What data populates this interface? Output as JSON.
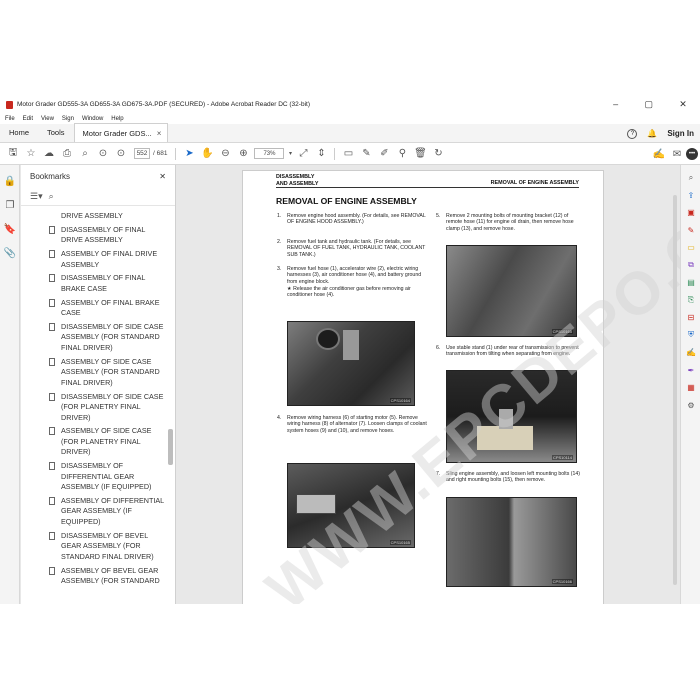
{
  "window": {
    "title": "Motor Grader GD555-3A GD655-3A GD675-3A.PDF (SECURED) - Adobe Acrobat Reader DC (32-bit)",
    "controls": [
      "–",
      "▢",
      "✕"
    ]
  },
  "menu": [
    "File",
    "Edit",
    "View",
    "Sign",
    "Window",
    "Help"
  ],
  "tabs": {
    "home": "Home",
    "tools": "Tools",
    "doc": "Motor Grader GDS...",
    "close": "×"
  },
  "header_right": {
    "help": "?",
    "bell": "🔔",
    "signin": "Sign In"
  },
  "toolbar": {
    "page_current": "552",
    "page_total": "/ 681",
    "zoom": "73%"
  },
  "bookmarks": {
    "title": "Bookmarks",
    "close": "✕",
    "items": [
      "DRIVE ASSEMBLY",
      "DISASSEMBLY OF FINAL DRIVE ASSEMBLY",
      "ASSEMBLY OF FINAL DRIVE ASSEMBLY",
      "DISASSEMBLY OF FINAL BRAKE CASE",
      "ASSEMBLY OF FINAL BRAKE CASE",
      "DISASSEMBLY OF SIDE CASE ASSEMBLY (FOR STANDARD FINAL DRIVER)",
      "ASSEMBLY OF SIDE CASE ASSEMBLY (FOR STANDARD FINAL DRIVER)",
      "DISASSEMBLY OF SIDE CASE (FOR PLANETRY FINAL DRIVER)",
      "ASSEMBLY OF SIDE CASE (FOR PLANETRY FINAL DRIVER)",
      "DISASSEMBLY OF DIFFERENTIAL GEAR ASSEMBLY (IF EQUIPPED)",
      "ASSEMBLY OF DIFFERENTIAL GEAR ASSEMBLY (IF EQUIPPED)",
      "DISASSEMBLY OF BEVEL GEAR ASSEMBLY (FOR STANDARD FINAL DRIVER)",
      "ASSEMBLY OF BEVEL GEAR ASSEMBLY (FOR STANDARD"
    ]
  },
  "page": {
    "head_left_1": "DISASSEMBLY",
    "head_left_2": "AND ASSEMBLY",
    "head_right": "REMOVAL OF ENGINE ASSEMBLY",
    "title": "REMOVAL OF ENGINE ASSEMBLY",
    "steps": {
      "s1_num": "1.",
      "s1": "Remove engine hood assembly. (For details, see REMOVAL OF ENGINE HOOD ASSEMBLY.)",
      "s2_num": "2.",
      "s2": "Remove fuel tank and hydraulic tank. (For details, see REMOVAL OF FUEL TANK, HYDRAULIC TANK, COOLANT SUB TANK.)",
      "s3_num": "3.",
      "s3": "Remove fuel hose (1), accelerator wire (2), electric wiring harnesses (3), air conditioner hose (4), and battery ground from engine block.",
      "s3_note": "★ Release the air conditioner gas before removing air conditioner hose (4).",
      "s4_num": "4.",
      "s4": "Remove wiring harness (6) of starting motor (5). Remove wiring harness (8) of alternator (7). Loosen clamps of coolant system hoses (9) and (10), and remove hoses.",
      "s5_num": "5.",
      "s5": "Remove 2 mounting bolts of mounting bracket (12) of remote hose (11) for engine oil drain, then remove hose clamp (13), and remove hose.",
      "s6_num": "6.",
      "s6": "Use stable stand (1) under rear of transmission to prevent transmission from tilting when separating from engine.",
      "s7_num": "7.",
      "s7": "Sling engine assembly, and loosen left mounting bolts (14) and right mounting bolts (15), then remove."
    },
    "photo_labels": [
      "CPS10164",
      "CPS10165",
      "CPS10165",
      "CPS10114",
      "CPS10166"
    ],
    "watermark": "WWW.EPCDEPO.COM"
  }
}
